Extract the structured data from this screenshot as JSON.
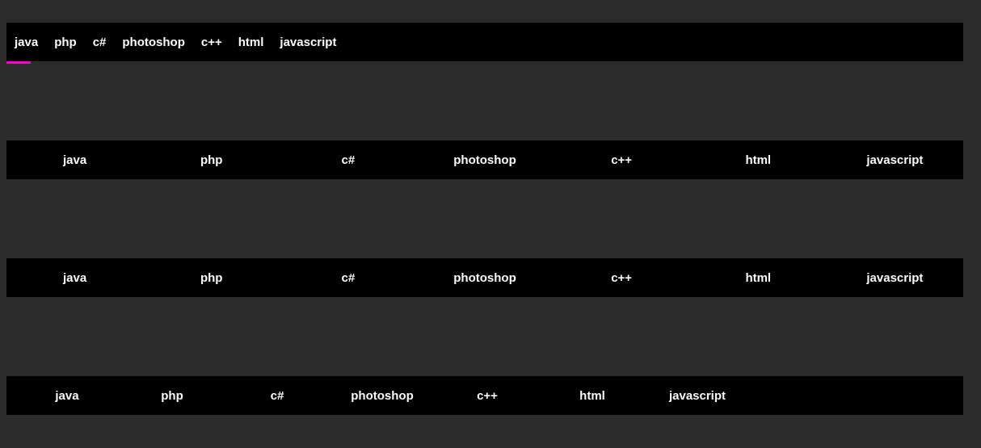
{
  "colors": {
    "background": "#2c2c2c",
    "navbar_bg": "#000000",
    "text": "#fcfcfc",
    "accent": "#ff00cc"
  },
  "tabs": [
    {
      "label": "java"
    },
    {
      "label": "php"
    },
    {
      "label": "c#"
    },
    {
      "label": "photoshop"
    },
    {
      "label": "c++"
    },
    {
      "label": "html"
    },
    {
      "label": "javascript"
    }
  ],
  "rows": {
    "row1": {
      "active_index": 0
    }
  }
}
